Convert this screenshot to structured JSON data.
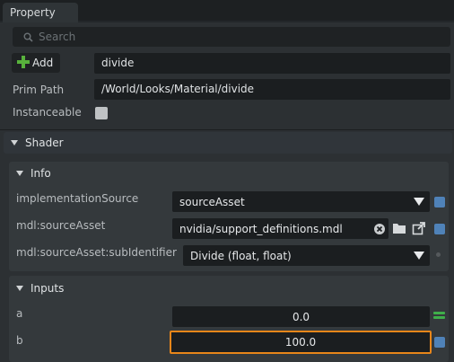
{
  "tab": {
    "title": "Property"
  },
  "search": {
    "placeholder": "Search"
  },
  "prim": {
    "add_label": "Add",
    "name_value": "divide",
    "path_label": "Prim Path",
    "path_value": "/World/Looks/Material/divide",
    "instanceable_label": "Instanceable"
  },
  "shader": {
    "title": "Shader",
    "info": {
      "title": "Info",
      "impl_label": "implementationSource",
      "impl_value": "sourceAsset",
      "asset_label": "mdl:sourceAsset",
      "asset_value": "nvidia/support_definitions.mdl",
      "subid_label": "mdl:sourceAsset:subIdentifier",
      "subid_value": "Divide (float, float)"
    },
    "inputs": {
      "title": "Inputs",
      "a_label": "a",
      "a_value": "0.0",
      "b_label": "b",
      "b_value": "100.0"
    }
  },
  "colors": {
    "accent_blue": "#4f82b8",
    "add_green": "#58b23c",
    "focus_orange": "#e8861a",
    "connected_green": "#3fae4a"
  }
}
